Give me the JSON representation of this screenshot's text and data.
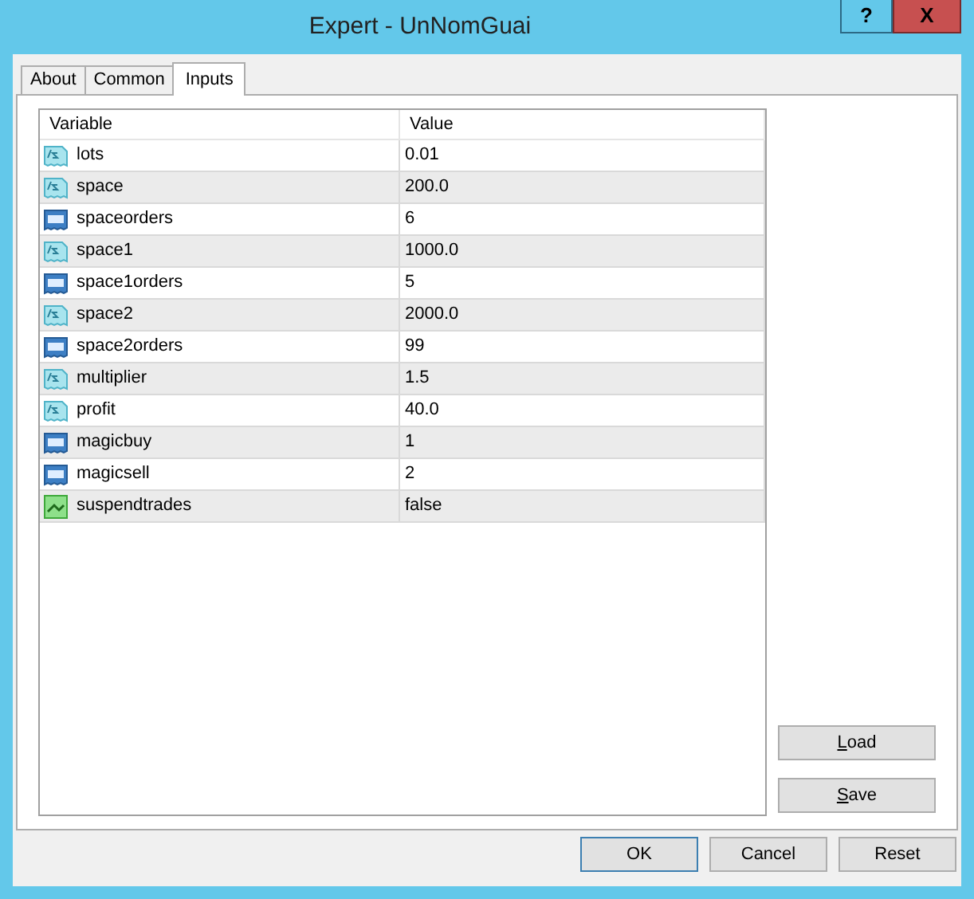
{
  "window": {
    "title": "Expert - UnNomGuai",
    "help_button": "?",
    "close_button": "X"
  },
  "tabs": [
    {
      "label": "About",
      "selected": false
    },
    {
      "label": "Common",
      "selected": false
    },
    {
      "label": "Inputs",
      "selected": true
    }
  ],
  "table": {
    "columns": [
      "Variable",
      "Value"
    ],
    "rows": [
      {
        "kind": "double",
        "variable": "lots",
        "value": "0.01"
      },
      {
        "kind": "double",
        "variable": "space",
        "value": "200.0"
      },
      {
        "kind": "int",
        "variable": "spaceorders",
        "value": "6"
      },
      {
        "kind": "double",
        "variable": "space1",
        "value": "1000.0"
      },
      {
        "kind": "int",
        "variable": "space1orders",
        "value": "5"
      },
      {
        "kind": "double",
        "variable": "space2",
        "value": "2000.0"
      },
      {
        "kind": "int",
        "variable": "space2orders",
        "value": "99"
      },
      {
        "kind": "double",
        "variable": "multiplier",
        "value": "1.5"
      },
      {
        "kind": "double",
        "variable": "profit",
        "value": "40.0"
      },
      {
        "kind": "int",
        "variable": "magicbuy",
        "value": "1"
      },
      {
        "kind": "int",
        "variable": "magicsell",
        "value": "2"
      },
      {
        "kind": "bool",
        "variable": "suspendtrades",
        "value": "false"
      }
    ]
  },
  "side_buttons": [
    {
      "label": "Load",
      "mnemonic": true
    },
    {
      "label": "Save",
      "mnemonic": true
    }
  ],
  "buttons": [
    {
      "label": "OK",
      "default": true
    },
    {
      "label": "Cancel",
      "default": false
    },
    {
      "label": "Reset",
      "default": false
    }
  ]
}
